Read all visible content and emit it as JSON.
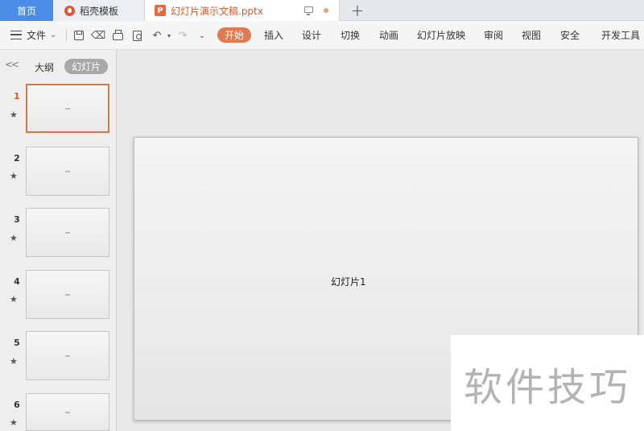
{
  "tabs": {
    "home": "首页",
    "template": "稻壳模板",
    "document": "幻灯片演示文稿.pptx",
    "document_icon_letter": "P"
  },
  "toolbar": {
    "file_label": "文件",
    "start_label": "开始",
    "menu": [
      "插入",
      "设计",
      "切换",
      "动画",
      "幻灯片放映",
      "审阅",
      "视图",
      "安全",
      "开发工具"
    ]
  },
  "left_panel": {
    "outline_label": "大纲",
    "slides_label": "幻灯片",
    "thumbnails": [
      {
        "number": "1",
        "star": "★"
      },
      {
        "number": "2",
        "star": "★"
      },
      {
        "number": "3",
        "star": "★"
      },
      {
        "number": "4",
        "star": "★"
      },
      {
        "number": "5",
        "star": "★"
      },
      {
        "number": "6",
        "star": "★"
      }
    ]
  },
  "slide": {
    "title": "幻灯片1"
  },
  "watermark": "软件技巧",
  "colors": {
    "home_tab": "#4b8de6",
    "accent": "#e07a4f",
    "doc_tab_text": "#d65b2c"
  },
  "icons": [
    "hamburger-icon",
    "save-icon",
    "format-painter-icon",
    "print-icon",
    "print-preview-icon",
    "undo-icon",
    "redo-icon",
    "more-icon",
    "monitor-icon",
    "add-tab-icon",
    "collapse-panel-icon"
  ]
}
